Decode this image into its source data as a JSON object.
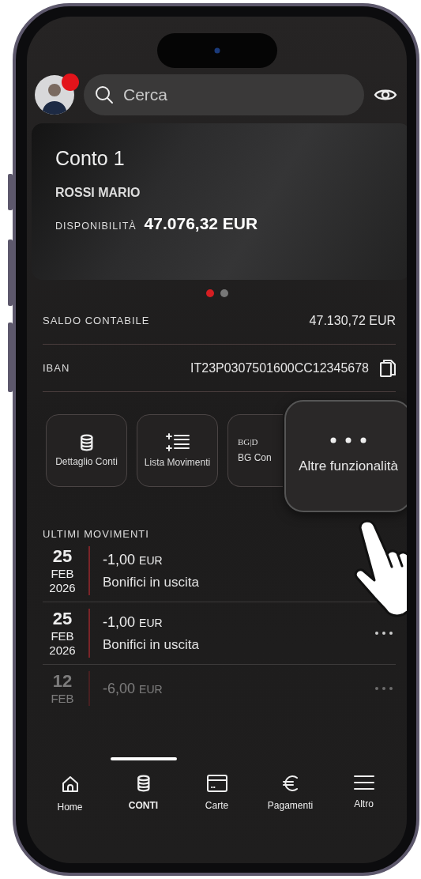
{
  "profile": {
    "notification": true
  },
  "search": {
    "placeholder": "Cerca"
  },
  "account_card": {
    "title": "Conto 1",
    "holder": "ROSSI MARIO",
    "available_label": "DISPONIBILITÀ",
    "available_amount": "47.076,32 EUR"
  },
  "carousel_dots": [
    {
      "selected": true
    },
    {
      "selected": false
    }
  ],
  "details": [
    {
      "label": "SALDO CONTABILE",
      "value": "47.130,72 EUR",
      "copyable": false
    },
    {
      "label": "IBAN",
      "value": "IT23P0307501600CC12345678",
      "copyable": true
    }
  ],
  "actions": [
    {
      "kind": "database",
      "label": "Dettaglio Conti"
    },
    {
      "kind": "list",
      "label": "Lista Movimenti"
    },
    {
      "kind": "logo",
      "logo": "BG|D",
      "label": "BG Con"
    }
  ],
  "highlighted_action": {
    "label": "Altre funzionalità"
  },
  "movements_title": "ULTIMI MOVIMENTI",
  "movements": [
    {
      "day": "25",
      "month": "FEB",
      "year": "2026",
      "amount": "-1,00",
      "currency": "EUR",
      "description": "Bonifici in uscita",
      "faded": false
    },
    {
      "day": "25",
      "month": "FEB",
      "year": "2026",
      "amount": "-1,00",
      "currency": "EUR",
      "description": "Bonifici in uscita",
      "faded": false
    },
    {
      "day": "12",
      "month": "FEB",
      "amount": "-6,00",
      "currency": "EUR",
      "faded": true
    }
  ],
  "tabs": [
    {
      "kind": "home",
      "label": "Home",
      "selected": false
    },
    {
      "kind": "database",
      "label": "CONTI",
      "selected": true
    },
    {
      "kind": "card",
      "label": "Carte",
      "selected": false
    },
    {
      "kind": "euro",
      "label": "Pagamenti",
      "selected": false
    },
    {
      "kind": "menu",
      "label": "Altro",
      "selected": false
    }
  ]
}
